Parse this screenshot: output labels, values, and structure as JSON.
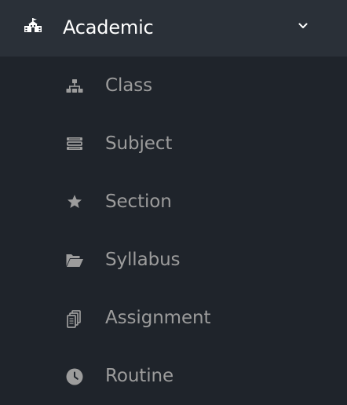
{
  "header": {
    "label": "Academic",
    "icon": "school-icon",
    "chevron_icon": "chevron-down-icon"
  },
  "submenu": {
    "items": [
      {
        "label": "Class",
        "icon": "sitemap-icon"
      },
      {
        "label": "Subject",
        "icon": "books-icon"
      },
      {
        "label": "Section",
        "icon": "star-icon"
      },
      {
        "label": "Syllabus",
        "icon": "folder-open-icon"
      },
      {
        "label": "Assignment",
        "icon": "copy-icon"
      },
      {
        "label": "Routine",
        "icon": "clock-icon"
      }
    ]
  },
  "colors": {
    "sidebar_background": "#1f242b",
    "header_background": "#2a3038",
    "header_text": "#ffffff",
    "item_text": "#9c9c9c",
    "icon_color": "#9c9c9c"
  }
}
